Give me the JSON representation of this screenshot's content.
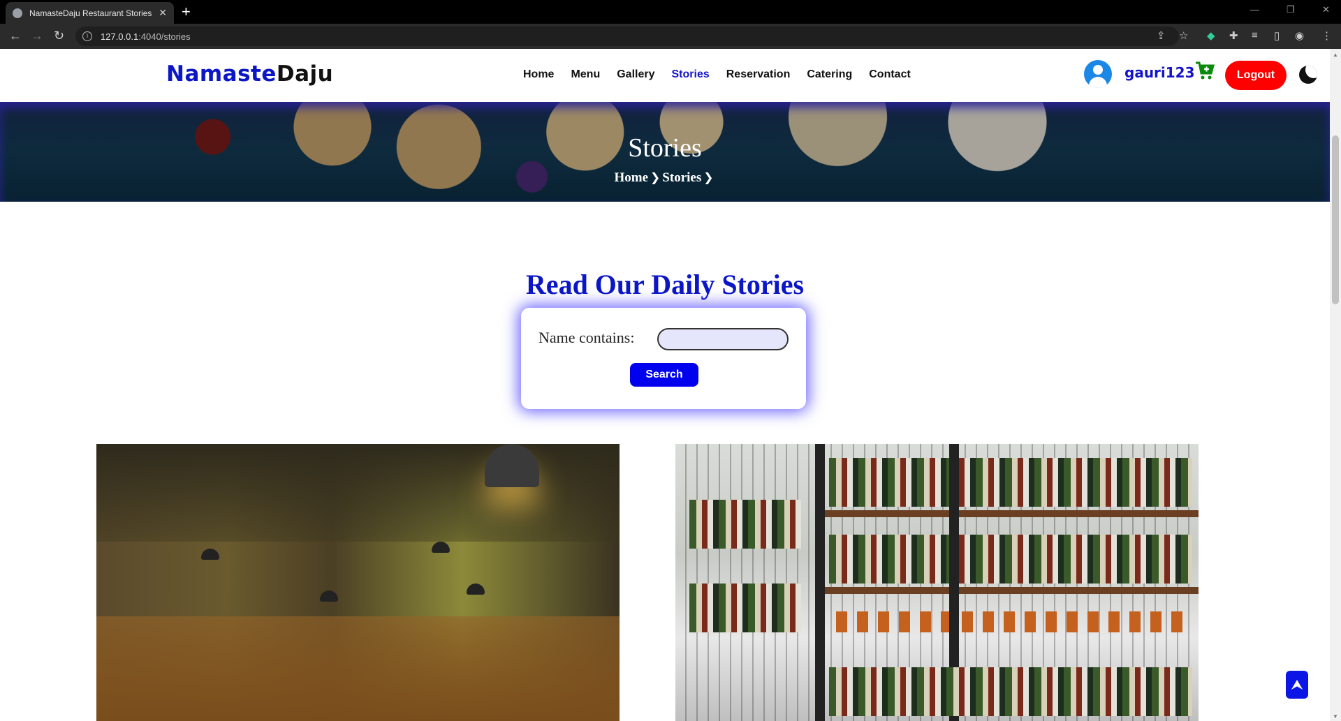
{
  "browser": {
    "tab_title": "NamasteDaju Restaurant Stories",
    "tab_close": "✕",
    "new_tab": "+",
    "url_host": "127.0.0.1",
    "url_path": ":4040/stories"
  },
  "header": {
    "logo_part1": "Namaste",
    "logo_part2": "Daju",
    "nav": [
      {
        "label": "Home",
        "active": false
      },
      {
        "label": "Menu",
        "active": false
      },
      {
        "label": "Gallery",
        "active": false
      },
      {
        "label": "Stories",
        "active": true
      },
      {
        "label": "Reservation",
        "active": false
      },
      {
        "label": "Catering",
        "active": false
      },
      {
        "label": "Contact",
        "active": false
      }
    ],
    "username": "gauri123",
    "logout_label": "Logout"
  },
  "hero": {
    "title": "Stories",
    "breadcrumb": [
      "Home",
      "Stories"
    ]
  },
  "main": {
    "section_title": "Read Our Daily Stories",
    "search_label": "Name contains:",
    "search_value": "",
    "search_button": "Search"
  },
  "colors": {
    "brand_blue": "#0b16c6",
    "logout_red": "#ff0000",
    "cart_green": "#0a8a0a",
    "search_button": "#0000ee"
  },
  "icons": {
    "scroll_top": "double-chevron-up-icon",
    "cart": "cart-plus-icon",
    "theme": "moon-icon"
  }
}
